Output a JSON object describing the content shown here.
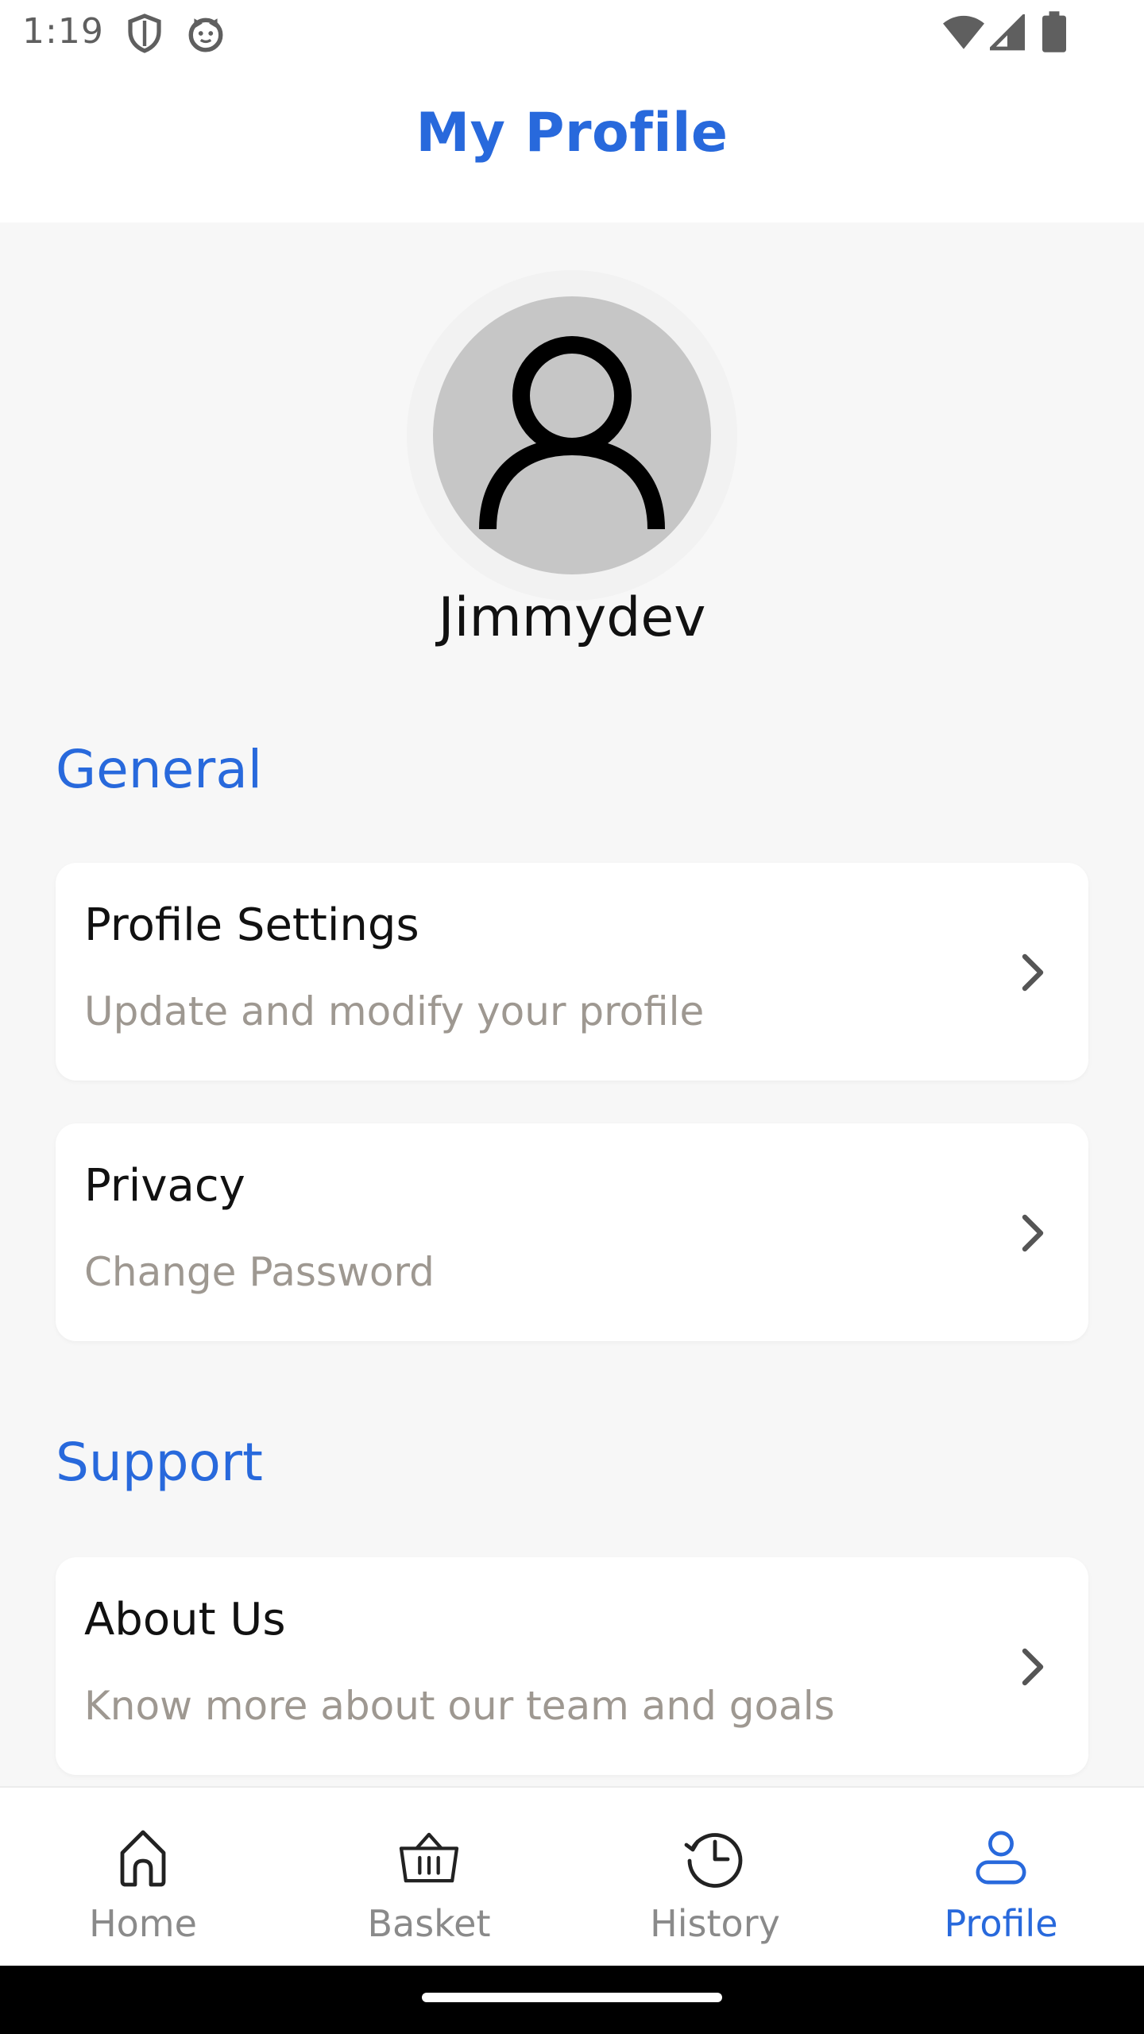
{
  "status_bar": {
    "time": "1:19",
    "left_icons": [
      "shield-icon",
      "cat-face-icon"
    ],
    "right_icons": [
      "wifi-icon",
      "cellular-signal-icon",
      "battery-icon"
    ]
  },
  "header": {
    "title": "My Profile"
  },
  "profile": {
    "avatar_icon": "person-icon",
    "username": "Jimmydev"
  },
  "sections": [
    {
      "title": "General",
      "items": [
        {
          "title": "Profile Settings",
          "subtitle": "Update and modify your profile"
        },
        {
          "title": "Privacy",
          "subtitle": "Change Password"
        }
      ]
    },
    {
      "title": "Support",
      "items": [
        {
          "title": "About Us",
          "subtitle": "Know more about our team and goals"
        }
      ]
    }
  ],
  "bottom_nav": {
    "items": [
      {
        "label": "Home",
        "icon": "home-icon",
        "active": false
      },
      {
        "label": "Basket",
        "icon": "basket-icon",
        "active": false
      },
      {
        "label": "History",
        "icon": "history-icon",
        "active": false
      },
      {
        "label": "Profile",
        "icon": "profile-icon",
        "active": true
      }
    ]
  },
  "colors": {
    "accent": "#2869dc",
    "background": "#f7f7f7",
    "card": "#ffffff",
    "subtitle": "#9e9891",
    "inactive_nav": "#8a8a8a"
  }
}
